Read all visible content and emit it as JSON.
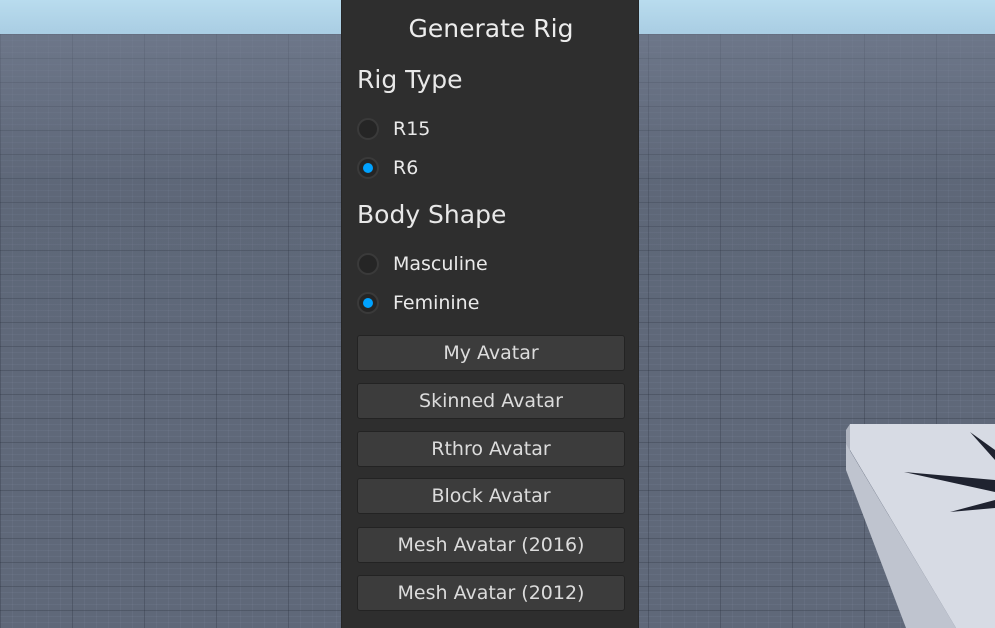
{
  "panel": {
    "title": "Generate Rig",
    "rig_type": {
      "heading": "Rig Type",
      "options": [
        {
          "label": "R15",
          "selected": false
        },
        {
          "label": "R6",
          "selected": true
        }
      ]
    },
    "body_shape": {
      "heading": "Body Shape",
      "options": [
        {
          "label": "Masculine",
          "selected": false
        },
        {
          "label": "Feminine",
          "selected": true
        }
      ]
    },
    "buttons": [
      "My Avatar",
      "Skinned Avatar",
      "Rthro Avatar",
      "Block Avatar",
      "Mesh Avatar (2016)",
      "Mesh Avatar (2012)"
    ]
  },
  "colors": {
    "panel_bg": "#2e2e2e",
    "button_bg": "#3c3c3c",
    "accent": "#00a2ff",
    "floor": "#5f6879",
    "sky": "#b9dcee"
  }
}
